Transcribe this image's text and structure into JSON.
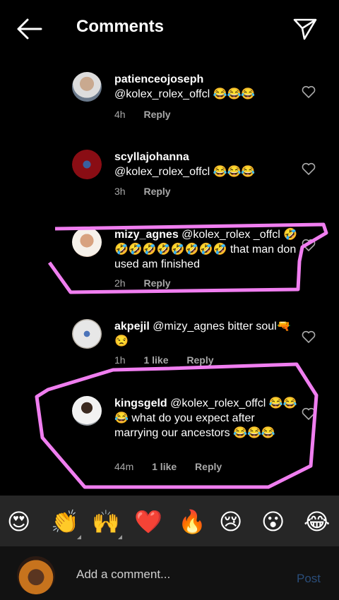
{
  "header": {
    "title": "Comments"
  },
  "comments": [
    {
      "user": "patienceojoseph",
      "text": "@kolex_rolex_offcl 😂😂😂",
      "time": "4h",
      "likes": "",
      "reply": "Reply"
    },
    {
      "user": "scyllajohanna",
      "text": "@kolex_rolex_offcl 😂😂😂",
      "time": "3h",
      "likes": "",
      "reply": "Reply"
    },
    {
      "user": "mizy_agnes",
      "text": "@kolex_rolex _offcl 🤣🤣🤣🤣🤣🤣🤣🤣🤣 that man don used am finished",
      "time": "2h",
      "likes": "",
      "reply": "Reply"
    },
    {
      "user": "akpejil",
      "text": "@mizy_agnes bitter soul🔫😒",
      "time": "1h",
      "likes": "1 like",
      "reply": "Reply"
    },
    {
      "user": "kingsgeld",
      "text": "@kolex_rolex_offcl 😂😂😂 what do you expect after marrying our ancestors 😂😂😂",
      "time": "44m",
      "likes": "1 like",
      "reply": "Reply"
    }
  ],
  "emoji_bar": [
    "😍",
    "👏",
    "🙌",
    "❤️",
    "🔥",
    "😢",
    "😮",
    "😂"
  ],
  "composer": {
    "placeholder": "Add a comment...",
    "post_label": "Post"
  },
  "colors": {
    "annotation": "#f07ef0",
    "post": "#2a4d7a"
  }
}
